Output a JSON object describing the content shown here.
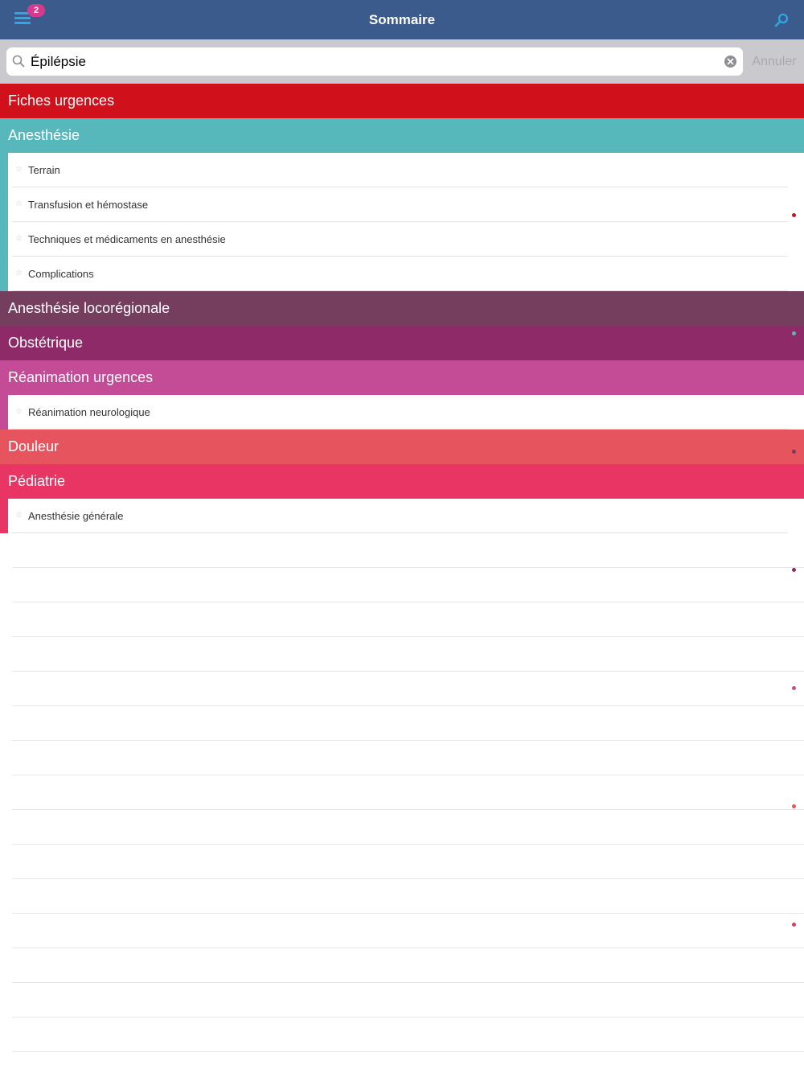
{
  "navbar": {
    "title": "Sommaire",
    "badge_count": "2",
    "menu_icon": "hamburger-icon",
    "search_icon": "search-icon",
    "accent_color": "#2fa7e0",
    "background": "#3b5b8c"
  },
  "search": {
    "value": "Épilépsie",
    "placeholder": "",
    "cancel_label": "Annuler"
  },
  "sections": [
    {
      "label": "Fiches urgences",
      "color": "#d0101a",
      "items": []
    },
    {
      "label": "Anesthésie",
      "color": "#57b8bc",
      "items": [
        {
          "label": "Terrain"
        },
        {
          "label": "Transfusion et hémostase"
        },
        {
          "label": "Techniques et médicaments en anesthésie"
        },
        {
          "label": "Complications"
        }
      ]
    },
    {
      "label": "Anesthésie locorégionale",
      "color": "#753d5e",
      "items": []
    },
    {
      "label": "Obstétrique",
      "color": "#8f2a68",
      "items": []
    },
    {
      "label": "Réanimation urgences",
      "color": "#c44b95",
      "items": [
        {
          "label": "Réanimation neurologique"
        }
      ]
    },
    {
      "label": "Douleur",
      "color": "#e6545e",
      "items": []
    },
    {
      "label": "Pédiatrie",
      "color": "#e83563",
      "items": [
        {
          "label": "Anesthésie générale"
        }
      ]
    }
  ],
  "index_dots": [
    "#d0101a",
    "#57b8bc",
    "#753d5e",
    "#8f2a68",
    "#c44b95",
    "#e6545e",
    "#e83563"
  ]
}
